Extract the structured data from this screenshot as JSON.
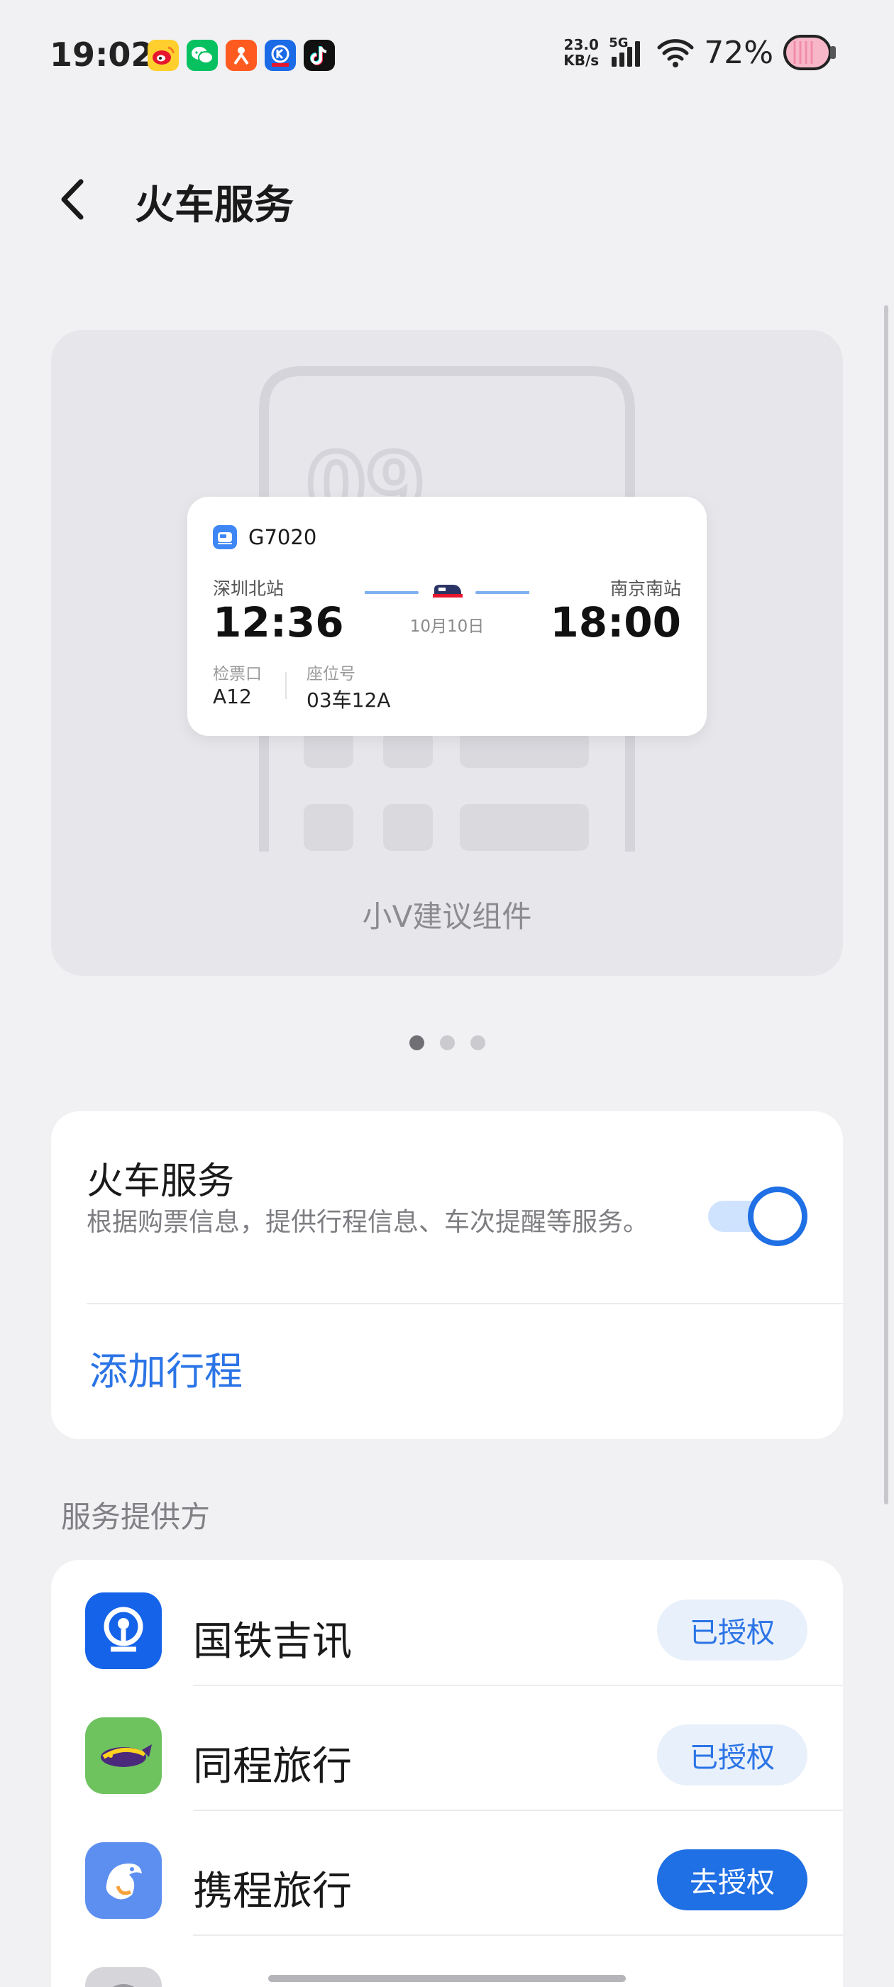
{
  "status_bar": {
    "time": "19:02",
    "net_speed_value": "23.0",
    "net_speed_unit": "KB/s",
    "network": "5G",
    "battery_percent": "72%",
    "notification_icons": [
      "weibo-icon",
      "wechat-icon",
      "taobao-icon",
      "kugou-icon",
      "tiktok-icon"
    ]
  },
  "header": {
    "title": "火车服务"
  },
  "preview": {
    "train_no": "G7020",
    "departure_station": "深圳北站",
    "arrival_station": "南京南站",
    "departure_time": "12:36",
    "arrival_time": "18:00",
    "date": "10月10日",
    "gate_label": "检票口",
    "gate_value": "A12",
    "seat_label": "座位号",
    "seat_value": "03车12A",
    "background_digits": "09",
    "caption": "小V建议组件"
  },
  "pager": {
    "count": 3,
    "active": 0
  },
  "service_card": {
    "title": "火车服务",
    "description": "根据购票信息，提供行程信息、车次提醒等服务。",
    "enabled": true,
    "add_trip_label": "添加行程"
  },
  "providers_section": {
    "label": "服务提供方",
    "providers": [
      {
        "name": "国铁吉讯",
        "status": "已授权"
      },
      {
        "name": "同程旅行",
        "status": "已授权"
      },
      {
        "name": "携程旅行",
        "status": "去授权"
      }
    ]
  },
  "colors": {
    "accent": "#1f6fe5",
    "link": "#2b74e6",
    "background": "#f1f1f3",
    "authorized_bg": "#e8f0fb"
  }
}
